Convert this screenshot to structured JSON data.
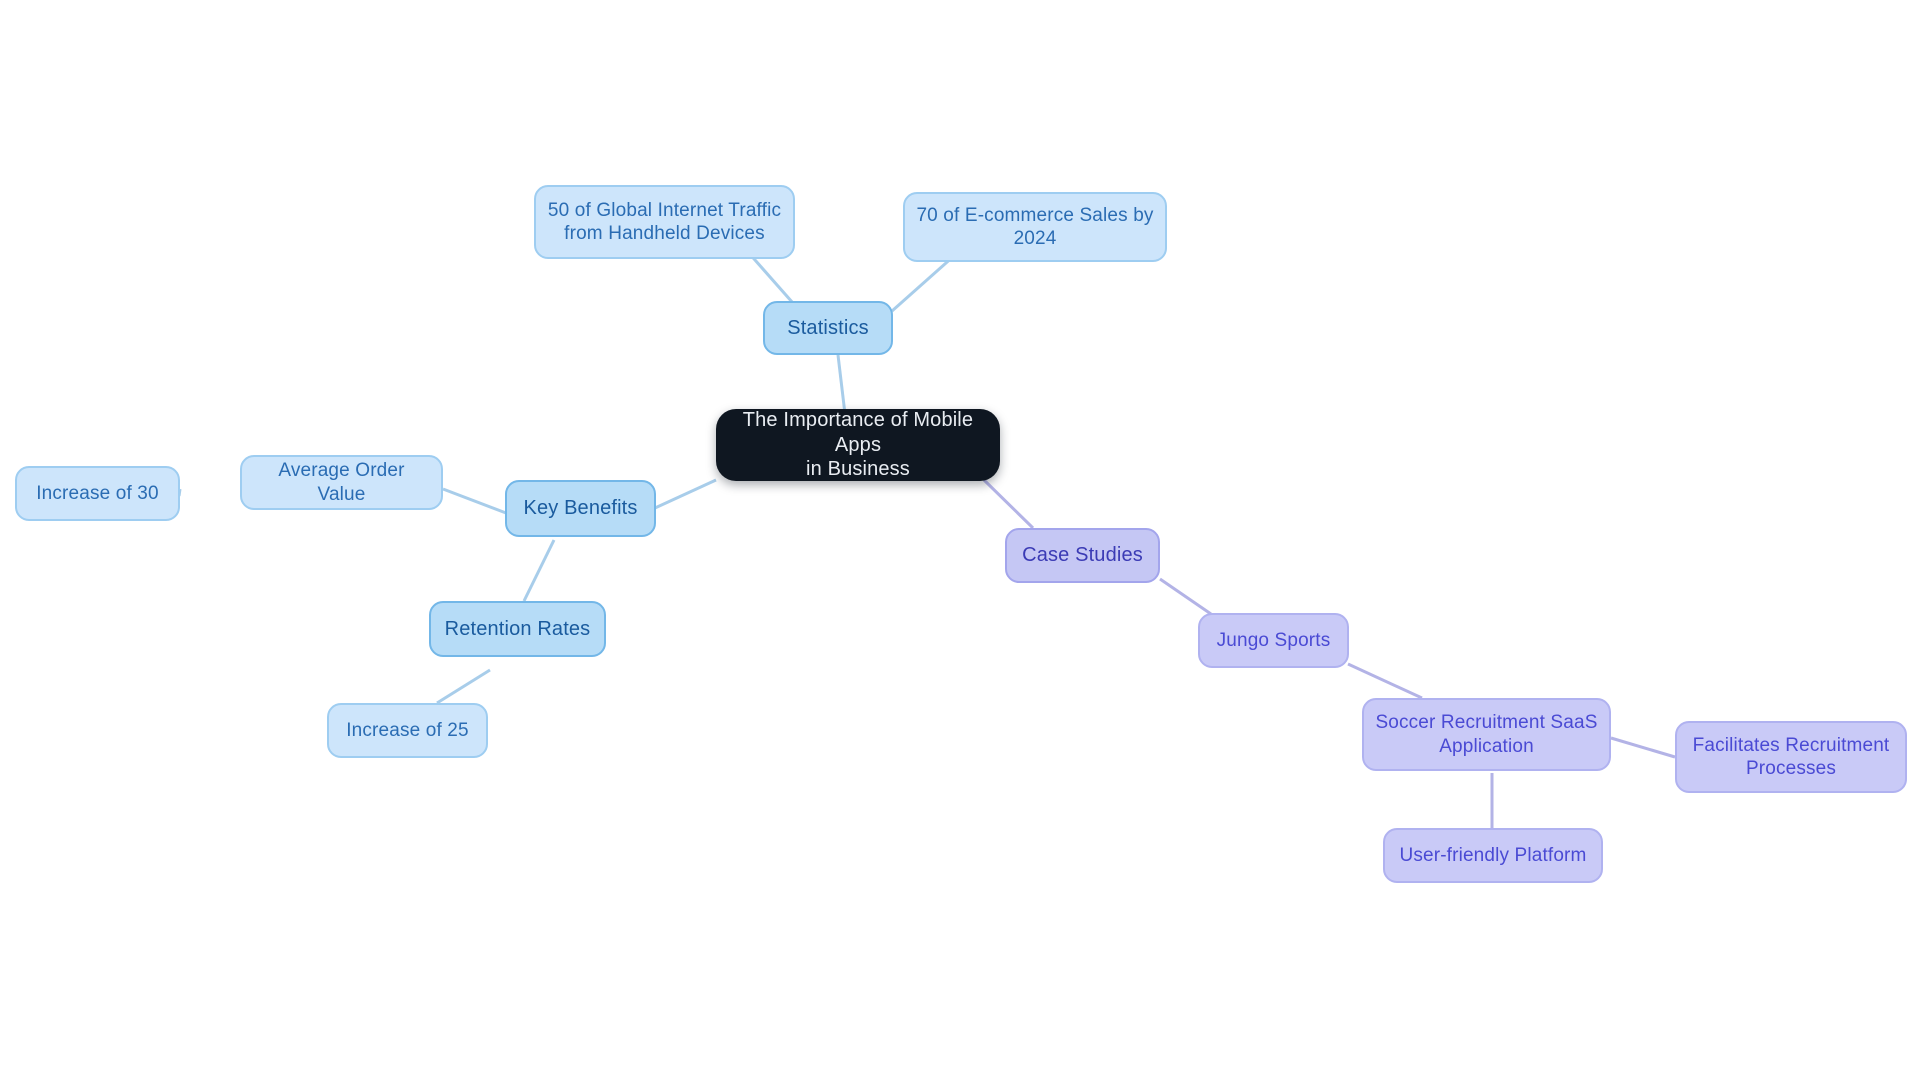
{
  "diagram": {
    "type": "mind-map",
    "title": "The Importance of Mobile Apps in Business",
    "background_color": "#ffffff",
    "palette": {
      "root_fill": "#0f1721",
      "root_text": "#e9edf2",
      "blue_branch_fill": "#b6dcf7",
      "blue_branch_border": "#73b7e8",
      "blue_branch_text": "#1a5b9e",
      "blue_leaf_fill": "#cde5fb",
      "blue_leaf_border": "#9ecdf1",
      "blue_leaf_text": "#2a6cb3",
      "purple_branch_fill": "#c5c7f4",
      "purple_branch_border": "#a3a5ec",
      "purple_branch_text": "#3b3bb5",
      "purple_leaf_fill": "#c9caf7",
      "purple_leaf_border": "#b0b2f0",
      "purple_leaf_text": "#4a4ad4",
      "blue_edge": "#a8cdea",
      "purple_edge": "#b3b3e6"
    }
  },
  "nodes": {
    "root": {
      "label": "The Importance of Mobile Apps\nin Business"
    },
    "statistics": {
      "label": "Statistics"
    },
    "stat_traffic": {
      "label": "50 of Global Internet Traffic\nfrom Handheld Devices"
    },
    "stat_ecommerce": {
      "label": "70 of E-commerce Sales by\n2024"
    },
    "key_benefits": {
      "label": "Key Benefits"
    },
    "average_order_value": {
      "label": "Average Order Value"
    },
    "increase_of_30": {
      "label": "Increase of 30"
    },
    "retention_rates": {
      "label": "Retention Rates"
    },
    "increase_of_25": {
      "label": "Increase of 25"
    },
    "case_studies": {
      "label": "Case Studies"
    },
    "jungo_sports": {
      "label": "Jungo Sports"
    },
    "soccer_recruitment": {
      "label": "Soccer Recruitment SaaS\nApplication"
    },
    "facilitates_recruitment": {
      "label": "Facilitates Recruitment\nProcesses"
    },
    "user_friendly_platform": {
      "label": "User-friendly Platform"
    }
  }
}
